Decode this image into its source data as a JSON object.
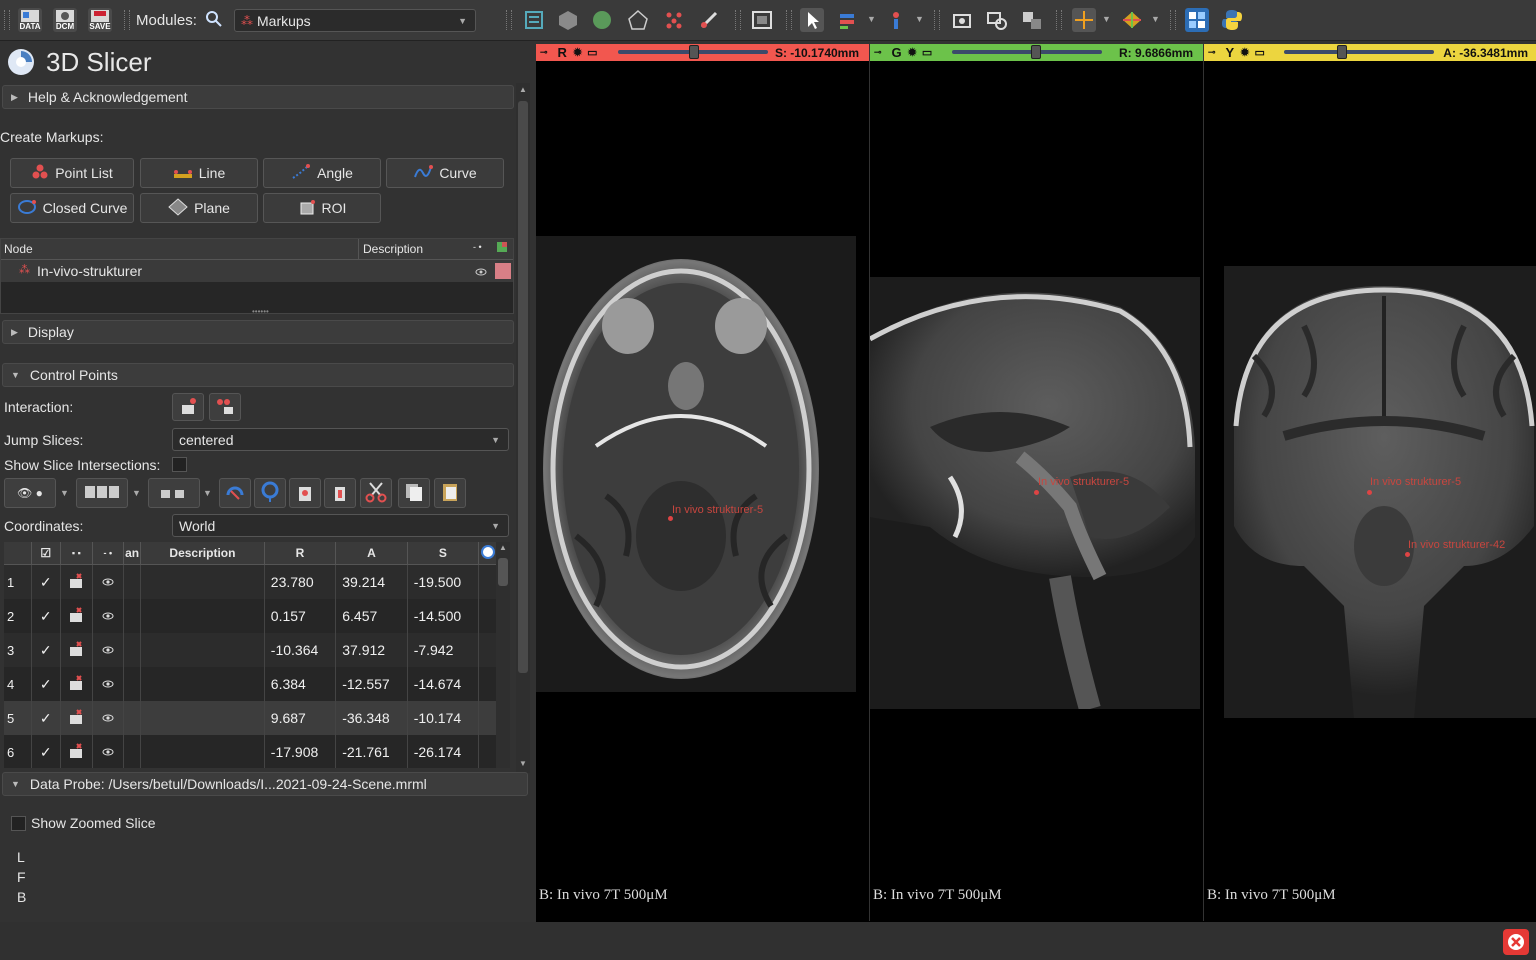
{
  "toolbar": {
    "data_label": "DATA",
    "dcm_label": "DCM",
    "save_label": "SAVE",
    "modules_label": "Modules:",
    "module_selected": "Markups"
  },
  "app": {
    "title": "3D Slicer"
  },
  "panel": {
    "help_section": "Help & Acknowledgement",
    "create_markups_label": "Create Markups:",
    "create_buttons": [
      "Point List",
      "Line",
      "Angle",
      "Curve",
      "Closed Curve",
      "Plane",
      "ROI"
    ],
    "node_header": "Node",
    "description_header": "Description",
    "node_name": "In-vivo-strukturer",
    "display_section": "Display",
    "control_points_section": "Control Points",
    "interaction_label": "Interaction:",
    "jump_slices_label": "Jump Slices:",
    "jump_slices_value": "centered",
    "show_slice_intersections_label": "Show Slice Intersections:",
    "coordinates_label": "Coordinates:",
    "coordinates_value": "World",
    "table_headers": {
      "name": "an",
      "description": "Description",
      "r": "R",
      "a": "A",
      "s": "S"
    },
    "rows": [
      {
        "index": "1",
        "r": "23.780",
        "a": "39.214",
        "s": "-19.500"
      },
      {
        "index": "2",
        "r": "0.157",
        "a": "6.457",
        "s": "-14.500"
      },
      {
        "index": "3",
        "r": "-10.364",
        "a": "37.912",
        "s": "-7.942"
      },
      {
        "index": "4",
        "r": "6.384",
        "a": "-12.557",
        "s": "-14.674"
      },
      {
        "index": "5",
        "r": "9.687",
        "a": "-36.348",
        "s": "-10.174"
      },
      {
        "index": "6",
        "r": "-17.908",
        "a": "-21.761",
        "s": "-26.174"
      }
    ],
    "data_probe": "Data Probe: /Users/betul/Downloads/I...2021-09-24-Scene.mrml",
    "show_zoomed_slice": "Show Zoomed Slice",
    "probe_lines": [
      "L",
      "F",
      "B"
    ]
  },
  "views": [
    {
      "letter": "R",
      "offset": "S: -10.1740mm",
      "bar_color": "#f2574f",
      "slider": 0.5,
      "bottom_label": "B: In vivo 7T 500μM",
      "markup_label": "In vivo strukturer-5"
    },
    {
      "letter": "G",
      "offset": "R: 9.6866mm",
      "bar_color": "#6cc24a",
      "slider": 0.55,
      "bottom_label": "B: In vivo 7T 500μM",
      "markup_label": "In vivo strukturer-5"
    },
    {
      "letter": "Y",
      "offset": "A: -36.3481mm",
      "bar_color": "#ecd53f",
      "slider": 0.38,
      "bottom_label": "B: In vivo 7T 500μM",
      "markup_label": "In vivo strukturer-5",
      "markup_label_2": "In vivo strukturer-42"
    }
  ],
  "icons": [
    "data-icon",
    "dicom-icon",
    "save-icon",
    "search-icon",
    "markups-icon",
    "python-icon",
    "close-error-icon",
    "eye-icon",
    "check-icon"
  ]
}
